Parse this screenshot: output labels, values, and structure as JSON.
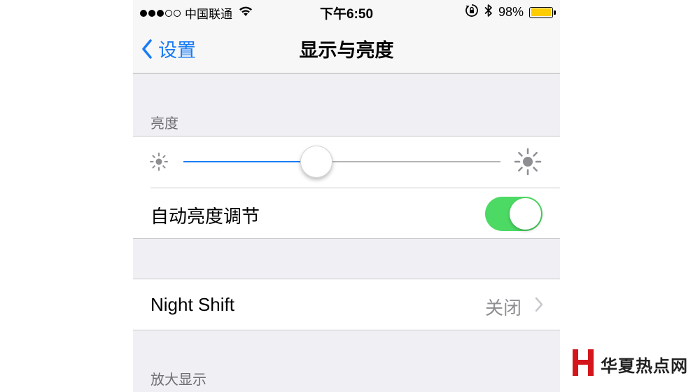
{
  "status_bar": {
    "signal_dots": [
      true,
      true,
      true,
      false,
      false
    ],
    "carrier": "中国联通",
    "wifi_icon": "wifi-icon",
    "time": "下午6:50",
    "lock_rotation_icon": "orientation-lock-icon",
    "bluetooth_icon": "bluetooth-icon",
    "battery_percent_label": "98%",
    "battery_level": 0.98,
    "battery_color": "#ffcc00"
  },
  "nav": {
    "back_label": "设置",
    "title": "显示与亮度"
  },
  "brightness_section": {
    "header": "亮度",
    "slider_value": 0.42,
    "min_icon": "sun-small-icon",
    "max_icon": "sun-large-icon",
    "auto_label": "自动亮度调节",
    "auto_enabled": true
  },
  "night_shift": {
    "label": "Night Shift",
    "value": "关闭"
  },
  "zoom_section": {
    "header": "放大显示"
  },
  "watermark": {
    "text": "华夏热点网"
  },
  "colors": {
    "accent": "#1a7cf5",
    "toggle_on": "#4cd964",
    "background": "#efeff4"
  }
}
